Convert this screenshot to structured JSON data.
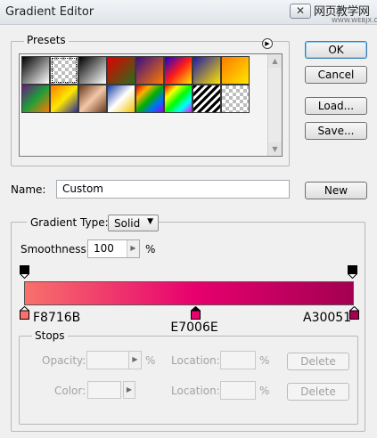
{
  "window": {
    "title": "Gradient Editor",
    "close_glyph": "✕",
    "watermark_main": "网页教学网",
    "watermark_sub": "WWW.WEBJX.COM"
  },
  "presets": {
    "legend": "Presets",
    "menu_icon": "presets-menu-arrow-icon",
    "swatches": [
      "linear-gradient(135deg,#000,#fff)",
      "repeating-conic-gradient(#bdbdbd 0 25%,#fff 0 50%) 0 0/8px 8px",
      "linear-gradient(135deg,#000,#fff)",
      "linear-gradient(135deg,#e10000,#2a6e1a)",
      "linear-gradient(135deg,#3a0d88,#ff7a00)",
      "linear-gradient(135deg,#1a00d6,#ff1a1a,#ffe600)",
      "linear-gradient(135deg,#1d1aa8,#ffe200)",
      "linear-gradient(135deg,#ff7a00,#ffe800)",
      "linear-gradient(135deg,#6b1a80,#1f9e3a,#ff7a00)",
      "linear-gradient(135deg,#ff7a00,#ffe800,#2a2a9a)",
      "linear-gradient(135deg,#6a3a1e,#f2c7a8,#6a3a1e)",
      "linear-gradient(135deg,#1a3ea8,#ffffff,#f2c200)",
      "linear-gradient(135deg,#e00000,#ffb000,#00b000,#0070ff,#9a00e0)",
      "linear-gradient(135deg,#ff0000,#ffff00,#00ff00,#00ffff,#ff00ff)",
      "repeating-linear-gradient(135deg,#000 0 3px,#fff 3px 6px)",
      "repeating-conic-gradient(#bdbdbd 0 25%,#fff 0 50%) 0 0/8px 8px"
    ],
    "selected_index": 1
  },
  "buttons": {
    "ok": "OK",
    "cancel": "Cancel",
    "load": "Load...",
    "save": "Save...",
    "new": "New"
  },
  "name_row": {
    "label": "Name:",
    "value": "Custom"
  },
  "gradient": {
    "type_label": "Gradient Type:",
    "type_value": "Solid",
    "smoothness_label": "Smoothness:",
    "smoothness_value": "100",
    "smoothness_unit": "%",
    "bar_colors": [
      "#F8716B",
      "#E7006E",
      "#A30051"
    ],
    "color_stops": [
      {
        "label": "F8716B",
        "color": "#F8716B",
        "location_pct": 0
      },
      {
        "label": "E7006E",
        "color": "#E7006E",
        "location_pct": 52
      },
      {
        "label": "A30051",
        "color": "#A30051",
        "location_pct": 100
      }
    ]
  },
  "stops": {
    "legend": "Stops",
    "opacity_label": "Opacity:",
    "color_label": "Color:",
    "location_label": "Location:",
    "percent": "%",
    "delete_label": "Delete"
  }
}
